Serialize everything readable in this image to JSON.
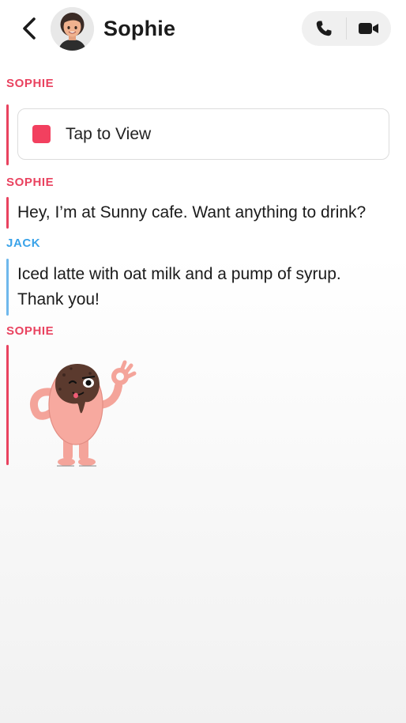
{
  "header": {
    "contact_name": "Sophie",
    "back_icon": "chevron-left-icon",
    "avatar": "bitmoji-avatar",
    "call_icon": "phone-icon",
    "video_icon": "video-camera-icon"
  },
  "messages": [
    {
      "sender": "SOPHIE",
      "type": "snap",
      "label": "Tap to View"
    },
    {
      "sender": "SOPHIE",
      "type": "text",
      "text": "Hey, I’m at Sunny cafe. Want anything to drink?"
    },
    {
      "sender": "JACK",
      "type": "text",
      "text": "Iced latte with oat milk and a pump of syrup. Thank you!"
    },
    {
      "sender": "SOPHIE",
      "type": "sticker",
      "sticker": "donut-mascot-ok-sticker"
    }
  ],
  "colors": {
    "sophie": "#e9425f",
    "jack": "#3aa3e9",
    "snap_square": "#f2405f"
  }
}
